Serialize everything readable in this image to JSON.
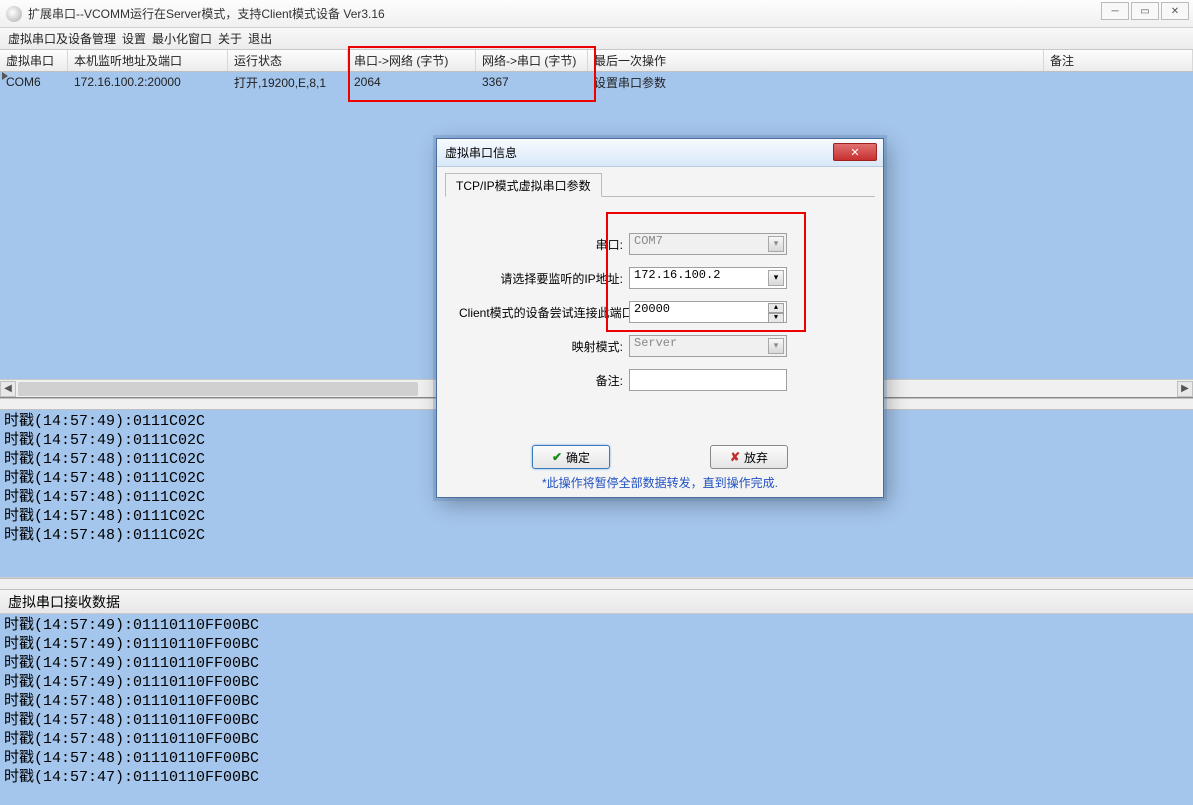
{
  "window": {
    "title": "扩展串口--VCOMM运行在Server模式，支持Client模式设备  Ver3.16"
  },
  "menu": {
    "devices": "虚拟串口及设备管理",
    "settings": "设置",
    "minimize": "最小化窗口",
    "about": "关于",
    "exit": "退出"
  },
  "grid": {
    "headers": {
      "serial": "虚拟串口",
      "addr": "本机监听地址及端口",
      "status": "运行状态",
      "tx": "串口->网络 (字节)",
      "rx": "网络->串口 (字节)",
      "lastop": "最后一次操作",
      "remark": "备注"
    },
    "row0": {
      "serial": "COM6",
      "addr": "172.16.100.2:20000",
      "status": "打开,19200,E,8,1",
      "tx": "2064",
      "rx": "3367",
      "lastop": "设置串口参数",
      "remark": ""
    }
  },
  "dialog": {
    "title": "虚拟串口信息",
    "tab": "TCP/IP模式虚拟串口参数",
    "labels": {
      "port": "串口",
      "ip": "请选择要监听的IP地址",
      "clientPort": "Client模式的设备尝试连接此端口",
      "mode": "映射模式",
      "remark": "备注"
    },
    "values": {
      "port": "COM7",
      "ip": "172.16.100.2",
      "clientPort": "20000",
      "mode": "Server",
      "remark": ""
    },
    "buttons": {
      "ok": "确定",
      "cancel": "放弃"
    },
    "footnote": "*此操作将暂停全部数据转发，直到操作完成."
  },
  "logs1": [
    "时戳(14:57:49):0111C02C",
    "时戳(14:57:49):0111C02C",
    "时戳(14:57:48):0111C02C",
    "时戳(14:57:48):0111C02C",
    "时戳(14:57:48):0111C02C",
    "时戳(14:57:48):0111C02C",
    "时戳(14:57:48):0111C02C"
  ],
  "logs2_header": "虚拟串口接收数据",
  "logs2": [
    "时戳(14:57:49):01110110FF00BC",
    "时戳(14:57:49):01110110FF00BC",
    "时戳(14:57:49):01110110FF00BC",
    "时戳(14:57:49):01110110FF00BC",
    "时戳(14:57:48):01110110FF00BC",
    "时戳(14:57:48):01110110FF00BC",
    "时戳(14:57:48):01110110FF00BC",
    "时戳(14:57:48):01110110FF00BC",
    "时戳(14:57:47):01110110FF00BC"
  ]
}
